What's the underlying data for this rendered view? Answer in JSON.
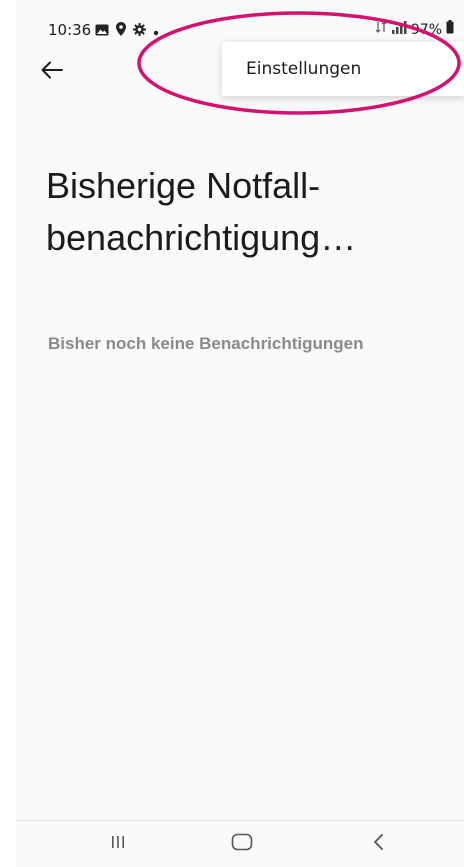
{
  "status_bar": {
    "time": "10:36",
    "battery": "97%",
    "left_icons": [
      "gallery-icon",
      "location-icon",
      "settings-icon",
      "dot-icon"
    ],
    "right_icons": [
      "wifi-data-icon",
      "signal-icon",
      "battery-icon"
    ]
  },
  "toolbar": {
    "back_icon": "arrow-left-icon"
  },
  "menu": {
    "items": [
      {
        "label": "Einstellungen"
      }
    ]
  },
  "main": {
    "title": "Bisherige Notfall-benachrichtigung…",
    "empty_message": "Bisher noch keine Benachrichtigungen"
  },
  "nav_bar": {
    "icons": [
      "recents-icon",
      "home-icon",
      "back-icon"
    ]
  },
  "colors": {
    "annotation": "#d6106e",
    "background": "#fafafa",
    "text_primary": "#1b1b1b",
    "text_secondary": "#8a8a8a"
  }
}
